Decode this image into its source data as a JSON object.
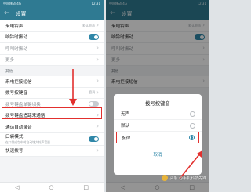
{
  "left": {
    "status": {
      "carrier": "中国移动 4G",
      "time": "12:31"
    },
    "title": "设置",
    "rows_top": [
      {
        "label": "来电铃声",
        "value": "默认铃声"
      },
      {
        "label": "响铃时振动",
        "toggle": true
      },
      {
        "label": "呼叫时振动",
        "dim": true
      },
      {
        "label": "更多",
        "dim": true
      }
    ],
    "section_other": "其他",
    "rows_other": [
      {
        "label": "来电拒接短信"
      },
      {
        "label": "拨号按键音",
        "value": "音调"
      },
      {
        "label": "拨号键盘单键切换",
        "dim": true,
        "toggle": false
      },
      {
        "label": "拨号键盘追踪来通话"
      },
      {
        "label": "通话自动录音"
      },
      {
        "label": "口袋模式",
        "sub": "在口袋或包中时自动增大铃声音量",
        "toggle": true
      },
      {
        "label": "快速拨号"
      }
    ]
  },
  "right": {
    "status": {
      "carrier": "中国移动 4G",
      "time": "12:31"
    },
    "title": "设置",
    "rows_top": [
      {
        "label": "来电铃声",
        "value": "默认铃声"
      },
      {
        "label": "响铃时振动",
        "toggle": true
      },
      {
        "label": "呼叫时振动",
        "dim": true
      },
      {
        "label": "更多",
        "dim": true
      }
    ],
    "section_other": "其他",
    "rows_other": [
      {
        "label": "来电拒接短信"
      }
    ],
    "dialog": {
      "title": "拨号按键音",
      "options": [
        {
          "label": "无声",
          "selected": false
        },
        {
          "label": "默认",
          "selected": false
        },
        {
          "label": "旋律",
          "selected": true
        }
      ],
      "cancel": "取消"
    }
  },
  "watermark": "头条 @手机科技先锋",
  "colors": {
    "accent": "#2f87a8",
    "header": "#2f7a92",
    "annotation": "#e2302e"
  }
}
